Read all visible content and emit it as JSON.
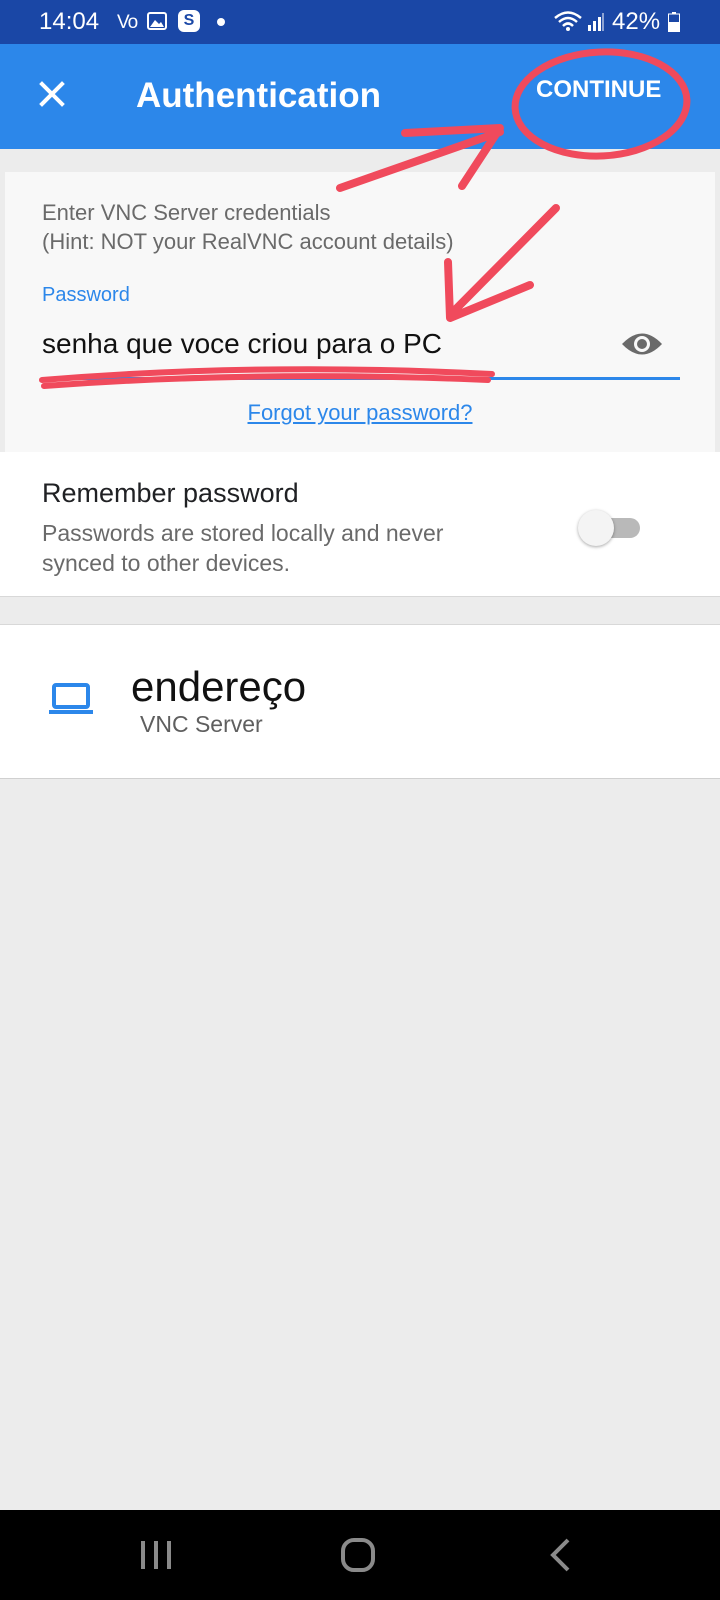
{
  "status_bar": {
    "time": "14:04",
    "volte": "Vo",
    "battery_percent": "42%",
    "icons": [
      "image-icon",
      "s-app-icon",
      "notification-dot",
      "wifi-icon",
      "signal-icon",
      "battery-icon"
    ]
  },
  "app_bar": {
    "title": "Authentication",
    "close_icon": "close-icon",
    "continue_label": "CONTINUE",
    "background_color": "#2c87ea"
  },
  "credentials": {
    "hint_line1": "Enter VNC Server credentials",
    "hint_line2": "(Hint: NOT your RealVNC account details)",
    "password_label": "Password",
    "password_value": "senha que voce criou para o PC",
    "forgot_link": "Forgot your password?",
    "accent_color": "#2c87ea"
  },
  "remember": {
    "title": "Remember password",
    "description_line1": "Passwords are stored locally and never",
    "description_line2": "synced to other devices.",
    "toggle_on": false
  },
  "server": {
    "name": "endereço",
    "type": "VNC Server",
    "icon": "laptop-icon"
  },
  "nav_bar": {
    "buttons": [
      "recent-apps-icon",
      "home-icon",
      "back-icon"
    ]
  },
  "annotation_color": "#f04a5c"
}
